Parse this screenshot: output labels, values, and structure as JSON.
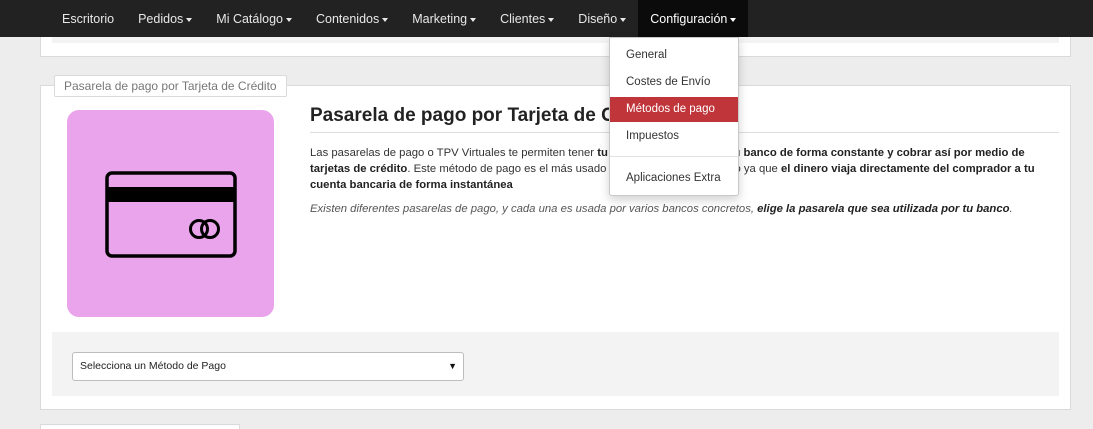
{
  "nav": {
    "items": [
      {
        "label": "Escritorio",
        "caret": false
      },
      {
        "label": "Pedidos",
        "caret": true
      },
      {
        "label": "Mi Catálogo",
        "caret": true
      },
      {
        "label": "Contenidos",
        "caret": true
      },
      {
        "label": "Marketing",
        "caret": true
      },
      {
        "label": "Clientes",
        "caret": true
      },
      {
        "label": "Diseño",
        "caret": true
      },
      {
        "label": "Configuración",
        "caret": true,
        "active": true
      }
    ]
  },
  "dropdown": {
    "items": [
      "General",
      "Costes de Envío",
      "Métodos de pago",
      "Impuestos"
    ],
    "selected": "Métodos de pago",
    "extra": "Aplicaciones Extra"
  },
  "panel": {
    "legend": "Pasarela de pago por Tarjeta de Crédito",
    "card_icon": "credit-card-icon",
    "card_bg_color": "#e9a4eb",
    "title": "Pasarela de pago por Tarjeta de Crédito",
    "para1": {
      "t1": "Las pasarelas de pago o TPV Virtuales te permiten tener ",
      "b1": "tu tienda conectada con tu banco de forma constante y cobrar así por medio de tarjetas de crédito",
      "t2": ". Este método de pago es el más usado en el comercio electrónico ya que ",
      "b2": "el dinero viaja directamente del comprador a tu cuenta bancaria de forma instantánea"
    },
    "para2": {
      "t1": "Existen diferentes pasarelas de pago, y cada una es usada por varios bancos concretos, ",
      "b1": "elige la pasarela que sea utilizada por tu banco",
      "t2": "."
    }
  },
  "payment_select": {
    "value": "Selecciona un Método de Pago",
    "arrow": "▼"
  },
  "colors": {
    "nav_bg": "#222222",
    "accent_selected": "#c0353a"
  }
}
